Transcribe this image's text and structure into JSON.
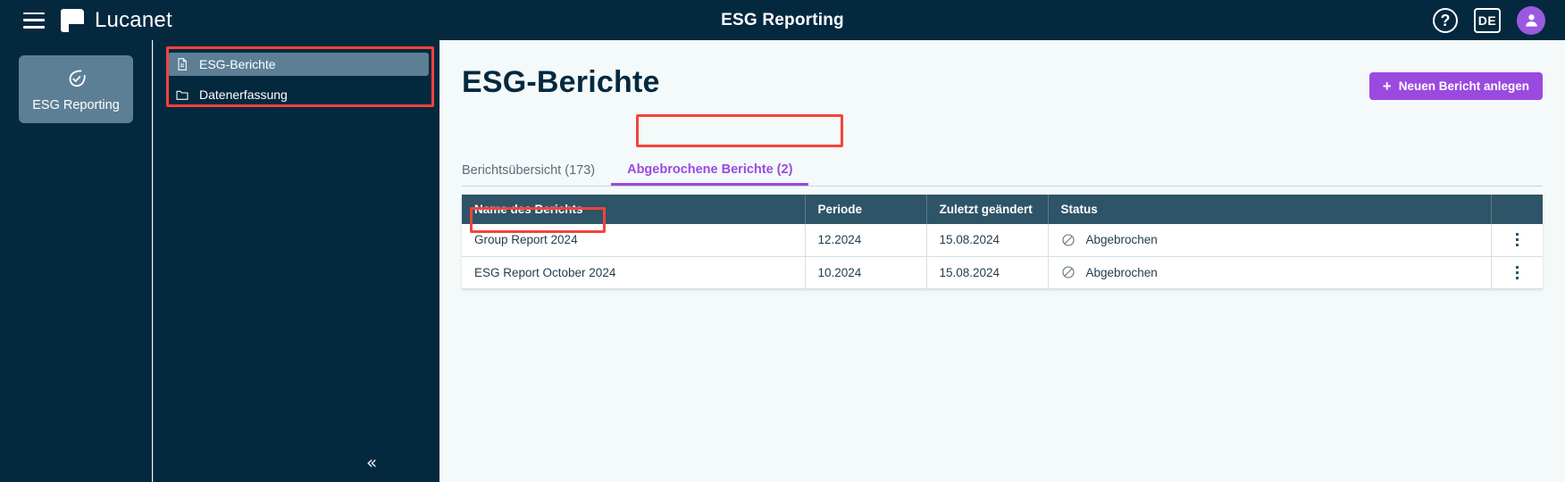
{
  "topbar": {
    "menu_icon": "hamburger-icon",
    "brand": "Lucanet",
    "title": "ESG Reporting",
    "help_icon": "help-circle-icon",
    "language": "DE",
    "avatar_icon": "user-avatar-icon"
  },
  "rail": {
    "items": [
      {
        "label": "ESG Reporting",
        "icon": "leaf-check-icon",
        "selected": true
      }
    ]
  },
  "nav": {
    "items": [
      {
        "label": "ESG-Berichte",
        "icon": "document-icon",
        "selected": true
      },
      {
        "label": "Datenerfassung",
        "icon": "folder-icon",
        "selected": false
      }
    ],
    "collapse_icon": "chevron-double-left-icon",
    "collapse_glyph": "«"
  },
  "main": {
    "page_title": "ESG-Berichte",
    "primary_button": {
      "label": "Neuen Bericht anlegen",
      "plus": "+"
    },
    "tabs": [
      {
        "label": "Berichtsübersicht (173)",
        "active": false
      },
      {
        "label": "Abgebrochene Berichte (2)",
        "active": true
      }
    ],
    "table": {
      "columns": [
        "Name des Berichts",
        "Periode",
        "Zuletzt geändert",
        "Status",
        ""
      ],
      "rows": [
        {
          "name": "Group Report 2024",
          "period": "12.2024",
          "modified": "15.08.2024",
          "status": "Abgebrochen",
          "status_icon": "cancelled-circle-icon",
          "menu_icon": "kebab-menu-icon"
        },
        {
          "name": "ESG Report October 2024",
          "period": "10.2024",
          "modified": "15.08.2024",
          "status": "Abgebrochen",
          "status_icon": "cancelled-circle-icon",
          "menu_icon": "kebab-menu-icon"
        }
      ]
    }
  },
  "colors": {
    "navy": "#04293f",
    "accent_purple": "#9b4ae0",
    "table_header": "#2e5468",
    "annotation_red": "#f4433c",
    "rail_selected": "#5d7f95",
    "page_bg": "#f4f9fa"
  }
}
